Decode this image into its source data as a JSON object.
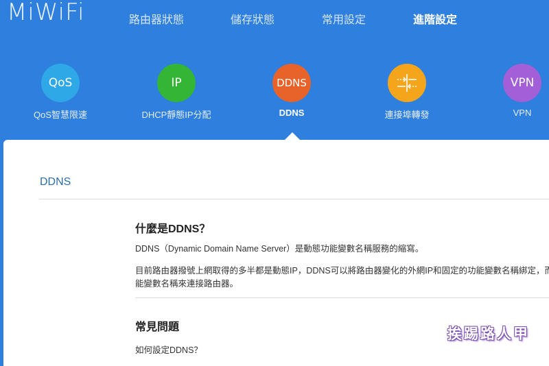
{
  "brand": {
    "logo": "MiWiFi"
  },
  "nav": {
    "items": [
      {
        "label": "路由器狀態"
      },
      {
        "label": "儲存狀態"
      },
      {
        "label": "常用設定"
      },
      {
        "label": "進階設定",
        "active": true
      }
    ]
  },
  "features": [
    {
      "icon_text": "QoS",
      "label": "QoS智慧限速",
      "color": "#2ea8e6"
    },
    {
      "icon_text": "IP",
      "label": "DHCP靜態IP分配",
      "color": "#34b535"
    },
    {
      "icon_text": "DDNS",
      "label": "DDNS",
      "color": "#e8632a",
      "active": true
    },
    {
      "icon_name": "port-forwarding-icon",
      "label": "連接埠轉發",
      "color": "#f4a51c"
    },
    {
      "icon_text": "VPN",
      "label": "VPN",
      "color": "#a35fd8"
    }
  ],
  "panel": {
    "title": "DDNS",
    "what_heading": "什麼是DDNS？",
    "what_p1": "DDNS（Dynamic Domain Name Server）是動態功能變數名稱服務的縮寫。",
    "what_p2_line1": "目前路由器撥號上網取得的多半都是動態IP，DDNS可以將路由器變化的外網IP和固定的功能變數名稱綁定，而使",
    "what_p2_line2": "能變數名稱來連接路由器。",
    "faq_heading": "常見問題",
    "faq_q1": "如何設定DDNS？"
  },
  "watermark": "挨踢路人甲"
}
